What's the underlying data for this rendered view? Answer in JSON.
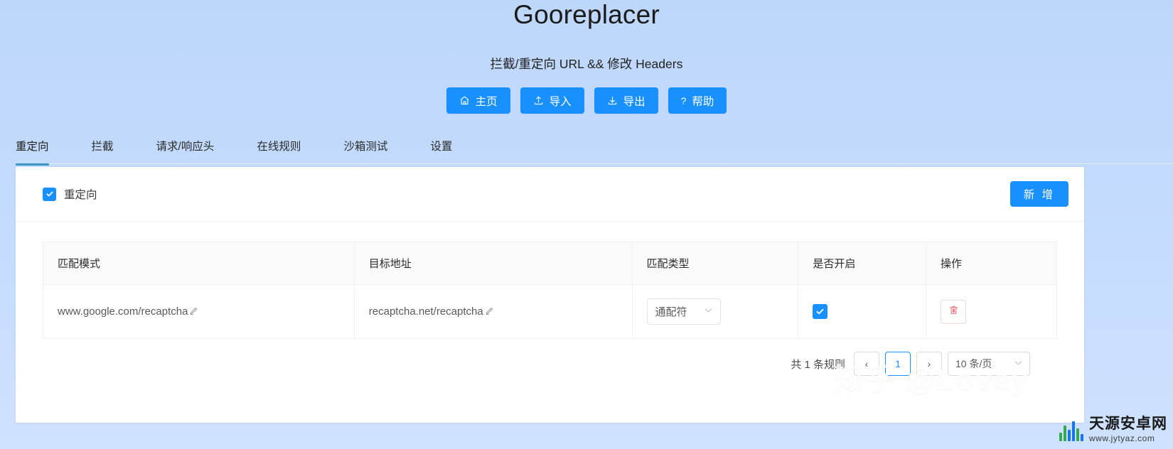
{
  "header": {
    "title": "Gooreplacer",
    "subtitle": "拦截/重定向 URL && 修改 Headers"
  },
  "toolbar": {
    "buttons": [
      {
        "label": "主页",
        "icon": "home-icon"
      },
      {
        "label": "导入",
        "icon": "upload-icon"
      },
      {
        "label": "导出",
        "icon": "download-icon"
      },
      {
        "label": "帮助",
        "icon": "question-icon"
      }
    ],
    "accent_color": "#1890ff"
  },
  "tabs": {
    "active_index": 0,
    "active_underline_color": "#3d96c4",
    "items": [
      {
        "label": "重定向"
      },
      {
        "label": "拦截"
      },
      {
        "label": "请求/响应头"
      },
      {
        "label": "在线规则"
      },
      {
        "label": "沙箱测试"
      },
      {
        "label": "设置"
      }
    ]
  },
  "panel": {
    "enabled": true,
    "enable_label": "重定向",
    "add_button_label": "新 增"
  },
  "table": {
    "columns": [
      "匹配模式",
      "目标地址",
      "匹配类型",
      "是否开启",
      "操作"
    ],
    "rows": [
      {
        "pattern": "www.google.com/recaptcha",
        "target": "recaptcha.net/recaptcha",
        "match_type": "通配符",
        "enabled": true,
        "edit_icon": "pencil-icon",
        "delete_icon": "trash-icon"
      }
    ]
  },
  "footer": {
    "total_text": "共 1 条规则",
    "pagination": {
      "prev_label": "‹",
      "pages": [
        "1"
      ],
      "current_page": "1",
      "next_label": "›",
      "page_size_label": "10 条/页",
      "page_size_caret": "⌄"
    }
  },
  "watermarks": {
    "zhihu": "知乎 @Lovey",
    "corner_title": "天源安卓网",
    "corner_sub": "www.jytyaz.com"
  }
}
